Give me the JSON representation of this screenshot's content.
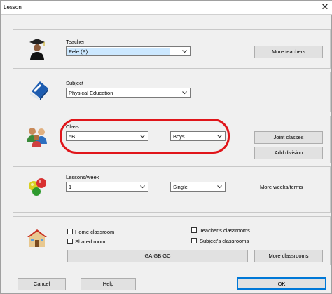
{
  "window": {
    "title": "Lesson",
    "close_glyph": "✕"
  },
  "teacher": {
    "label": "Teacher",
    "value": "Pele (P)",
    "more_button": "More teachers",
    "icon": "teacher-icon"
  },
  "subject": {
    "label": "Subject",
    "value": "Physical Education",
    "icon": "book-icon"
  },
  "class": {
    "label": "Class",
    "value": "5B",
    "group_value": "Boys",
    "joint_button": "Joint classes",
    "division_button": "Add division",
    "icon": "students-icon"
  },
  "lessons": {
    "label": "Lessons/week",
    "value": "1",
    "type_value": "Single",
    "more_weeks_label": "More weeks/terms",
    "icon": "balls-icon"
  },
  "classroom": {
    "home_label": "Home classroom",
    "shared_label": "Shared room",
    "teachers_label": "Teacher's classrooms",
    "subjects_label": "Subject's classrooms",
    "rooms_value": "GA,GB,GC",
    "more_button": "More classrooms",
    "icon": "house-icon"
  },
  "footer": {
    "cancel": "Cancel",
    "help": "Help",
    "ok": "OK"
  },
  "colors": {
    "highlight": "#e0151a",
    "selection": "#cce8ff",
    "ok_border": "#0078d7"
  }
}
